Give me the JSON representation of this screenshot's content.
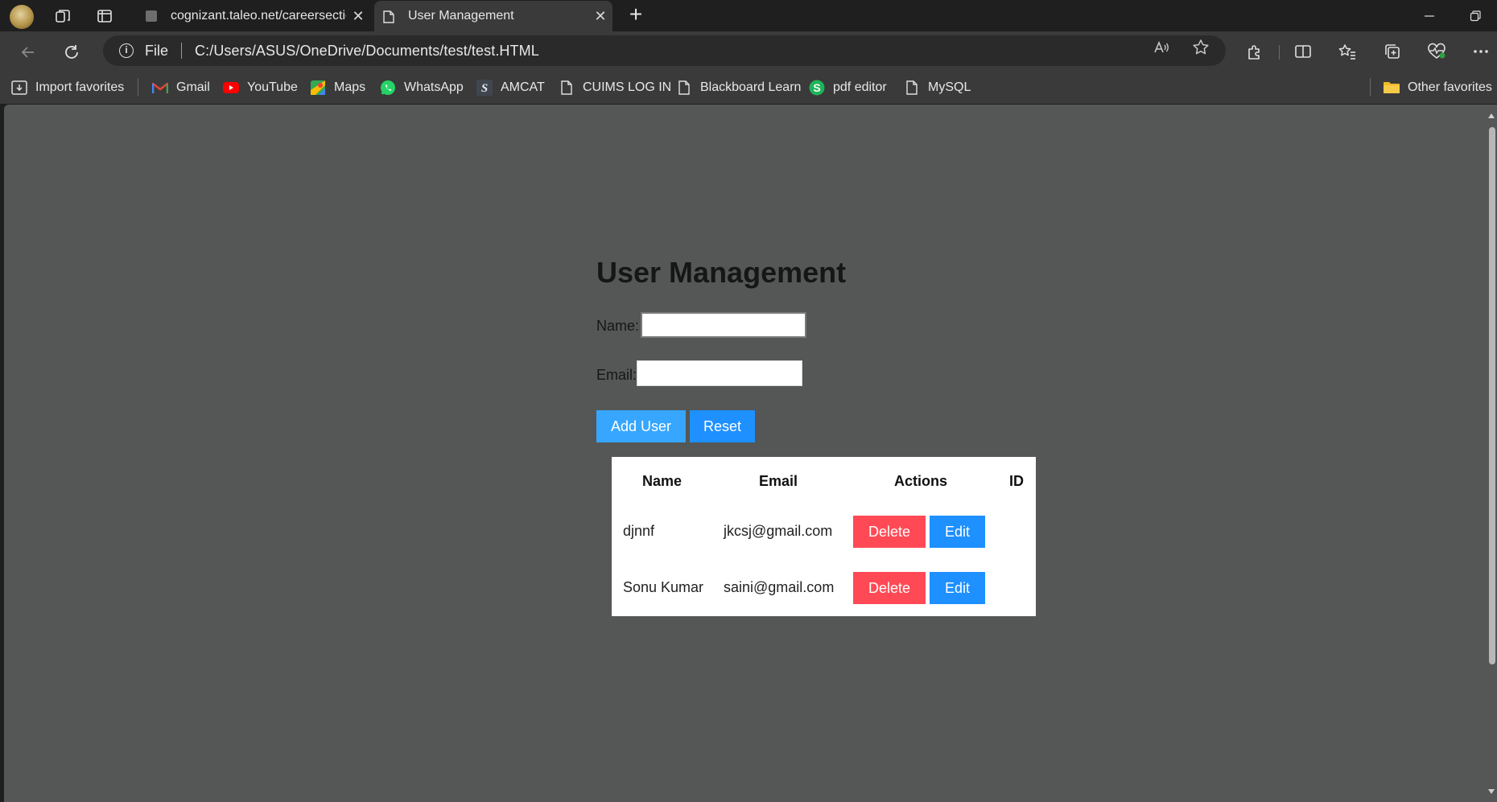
{
  "browser": {
    "tabs": [
      {
        "title": "cognizant.taleo.net/careersection",
        "active": false
      },
      {
        "title": "User Management",
        "active": true
      }
    ],
    "address": {
      "scheme": "File",
      "url": "C:/Users/ASUS/OneDrive/Documents/test/test.HTML"
    },
    "favorites": [
      {
        "label": "Import favorites",
        "icon": "import-icon"
      },
      {
        "label": "Gmail",
        "icon": "gmail-icon"
      },
      {
        "label": "YouTube",
        "icon": "youtube-icon"
      },
      {
        "label": "Maps",
        "icon": "maps-icon"
      },
      {
        "label": "WhatsApp",
        "icon": "whatsapp-icon"
      },
      {
        "label": "AMCAT",
        "icon": "amcat-icon"
      },
      {
        "label": "CUIMS LOG IN",
        "icon": "page-icon"
      },
      {
        "label": "Blackboard Learn",
        "icon": "page-icon"
      },
      {
        "label": "pdf editor",
        "icon": "pdf-editor-icon"
      },
      {
        "label": "MySQL",
        "icon": "page-icon"
      }
    ],
    "other_favorites": "Other favorites"
  },
  "page": {
    "title": "User Management",
    "form": {
      "name_label": "Name:",
      "name_value": "",
      "email_label": "Email:",
      "email_value": "",
      "add_label": "Add User",
      "reset_label": "Reset"
    },
    "table": {
      "headers": [
        "Name",
        "Email",
        "Actions",
        "ID"
      ],
      "rows": [
        {
          "name": "djnnf",
          "email": "jkcsj@gmail.com",
          "delete": "Delete",
          "edit": "Edit",
          "id": ""
        },
        {
          "name": "Sonu Kumar",
          "email": "saini@gmail.com",
          "delete": "Delete",
          "edit": "Edit",
          "id": ""
        }
      ]
    }
  },
  "colors": {
    "page_bg": "#545756",
    "add_button": "#36a6ff",
    "reset_button": "#1e90ff",
    "delete_button": "#ff4a55",
    "edit_button": "#1e90ff"
  }
}
